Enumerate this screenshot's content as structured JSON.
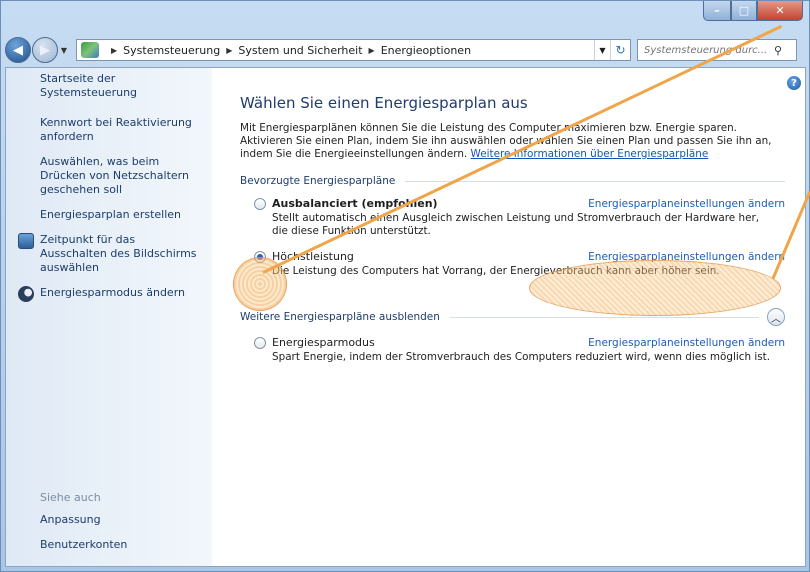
{
  "navbar": {
    "breadcrumbs": [
      "Systemsteuerung",
      "System und Sicherheit",
      "Energieoptionen"
    ],
    "search_placeholder": "Systemsteuerung durc..."
  },
  "sidebar": {
    "home": "Startseite der Systemsteuerung",
    "items": [
      "Kennwort bei Reaktivierung anfordern",
      "Auswählen, was beim Drücken von Netzschaltern geschehen soll",
      "Energiesparplan erstellen",
      "Zeitpunkt für das Ausschalten des Bildschirms auswählen",
      "Energiesparmodus ändern"
    ],
    "see_also_title": "Siehe auch",
    "see_also": [
      "Anpassung",
      "Benutzerkonten"
    ]
  },
  "main": {
    "title": "Wählen Sie einen Energiesparplan aus",
    "intro": "Mit Energiesparplänen können Sie die Leistung des Computer maximieren bzw. Energie sparen. Aktivieren Sie einen Plan, indem Sie ihn auswählen oder wählen Sie einen Plan und passen Sie ihn an, indem Sie die Energieeinstellungen ändern.",
    "intro_link": "Weitere Informationen über Energiesparpläne",
    "preferred_group": "Bevorzugte Energiesparpläne",
    "hidden_group": "Weitere Energiesparpläne ausblenden",
    "plans": [
      {
        "name": "Ausbalanciert (empfohlen)",
        "link": "Energiesparplaneinstellungen ändern",
        "desc": "Stellt automatisch einen Ausgleich zwischen Leistung und Stromverbrauch der Hardware her, die diese Funktion unterstützt."
      },
      {
        "name": "Höchstleistung",
        "link": "Energiesparplaneinstellungen ändern",
        "desc": "Die Leistung des Computers hat Vorrang, der Energieverbrauch kann aber höher sein."
      },
      {
        "name": "Energiesparmodus",
        "link": "Energiesparplaneinstellungen ändern",
        "desc": "Spart Energie, indem der Stromverbrauch des Computers reduziert wird, wenn dies möglich ist."
      }
    ]
  },
  "colors": {
    "highlight": "#f0a54a",
    "link": "#1d5cb5",
    "title": "#1e3c6e"
  }
}
